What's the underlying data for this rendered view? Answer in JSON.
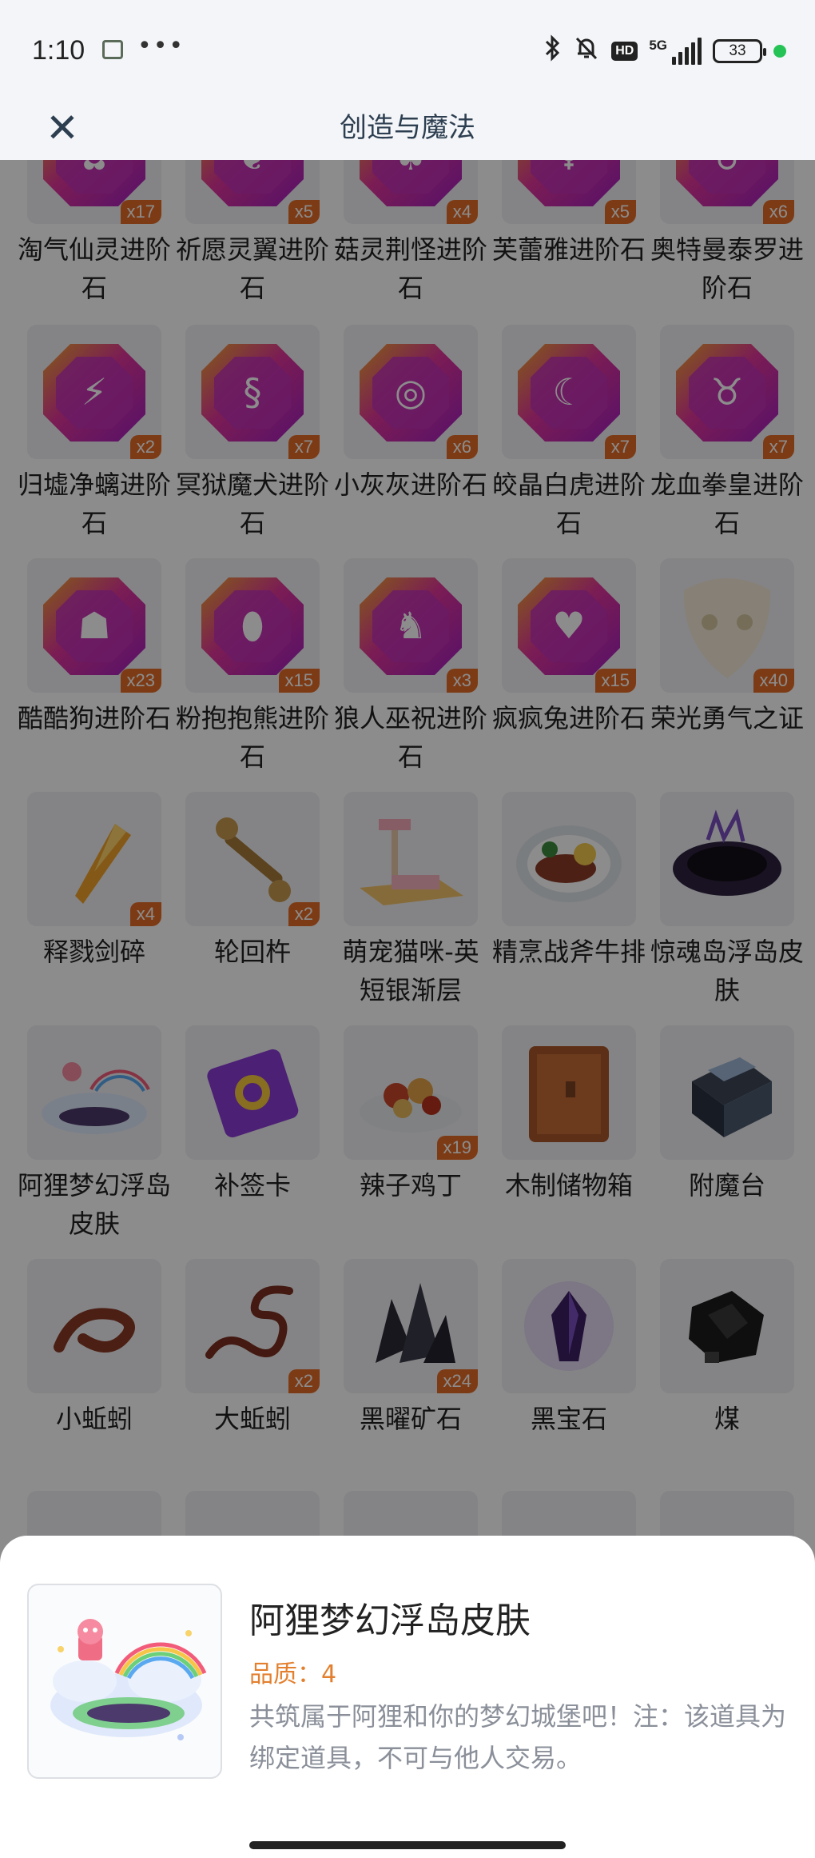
{
  "status_bar": {
    "time": "1:10",
    "dots": "•••",
    "network": "5G",
    "hd": "HD",
    "battery": "33"
  },
  "nav": {
    "title": "创造与魔法",
    "close_glyph": "✕"
  },
  "items": [
    {
      "name": "淘气仙灵进阶石",
      "qty": "x17",
      "icon": "gem-fairy-icon"
    },
    {
      "name": "祈愿灵翼进阶石",
      "qty": "x5",
      "icon": "gem-wing-icon"
    },
    {
      "name": "菇灵荆怪进阶石",
      "qty": "x4",
      "icon": "gem-mushroom-icon"
    },
    {
      "name": "芙蕾雅进阶石",
      "qty": "x5",
      "icon": "gem-freya-icon"
    },
    {
      "name": "奥特曼泰罗进阶石",
      "qty": "x6",
      "icon": "gem-ultraman-icon"
    },
    {
      "name": "归墟净螭进阶石",
      "qty": "x2",
      "icon": "gem-dragon-icon"
    },
    {
      "name": "冥狱魔犬进阶石",
      "qty": "x7",
      "icon": "gem-hellhound-icon"
    },
    {
      "name": "小灰灰进阶石",
      "qty": "x6",
      "icon": "gem-lollipop-icon"
    },
    {
      "name": "皎晶白虎进阶石",
      "qty": "x7",
      "icon": "gem-tiger-icon"
    },
    {
      "name": "龙血拳皇进阶石",
      "qty": "x7",
      "icon": "gem-horns-icon"
    },
    {
      "name": "酷酷狗进阶石",
      "qty": "x23",
      "icon": "gem-dog-icon"
    },
    {
      "name": "粉抱抱熊进阶石",
      "qty": "x15",
      "icon": "gem-egg-icon"
    },
    {
      "name": "狼人巫祝进阶石",
      "qty": "x3",
      "icon": "gem-werewolf-icon"
    },
    {
      "name": "疯疯兔进阶石",
      "qty": "x15",
      "icon": "gem-carrot-icon"
    },
    {
      "name": "荣光勇气之证",
      "qty": "x40",
      "icon": "glory-mask-icon"
    },
    {
      "name": "释戮剑碎",
      "qty": "x4",
      "icon": "sword-shard-icon"
    },
    {
      "name": "轮回杵",
      "qty": "x2",
      "icon": "pestle-icon"
    },
    {
      "name": "萌宠猫咪-英短银渐层",
      "qty": "",
      "icon": "cat-tower-icon"
    },
    {
      "name": "精烹战斧牛排",
      "qty": "",
      "icon": "steak-plate-icon"
    },
    {
      "name": "惊魂岛浮岛皮肤",
      "qty": "",
      "icon": "dark-island-icon"
    },
    {
      "name": "阿狸梦幻浮岛皮肤",
      "qty": "",
      "icon": "dream-island-icon"
    },
    {
      "name": "补签卡",
      "qty": "",
      "icon": "checkin-card-icon"
    },
    {
      "name": "辣子鸡丁",
      "qty": "x19",
      "icon": "spicy-chicken-icon"
    },
    {
      "name": "木制储物箱",
      "qty": "",
      "icon": "wooden-box-icon"
    },
    {
      "name": "附魔台",
      "qty": "",
      "icon": "enchant-table-icon"
    },
    {
      "name": "小蚯蚓",
      "qty": "",
      "icon": "small-worm-icon"
    },
    {
      "name": "大蚯蚓",
      "qty": "x2",
      "icon": "big-worm-icon"
    },
    {
      "name": "黑曜矿石",
      "qty": "x24",
      "icon": "obsidian-ore-icon"
    },
    {
      "name": "黑宝石",
      "qty": "",
      "icon": "black-gem-icon"
    },
    {
      "name": "煤",
      "qty": "",
      "icon": "coal-icon"
    },
    {
      "name": "",
      "qty": "",
      "icon": "partial-item-icon"
    },
    {
      "name": "",
      "qty": "",
      "icon": "partial-item-icon"
    },
    {
      "name": "",
      "qty": "",
      "icon": "partial-item-icon"
    },
    {
      "name": "",
      "qty": "",
      "icon": "partial-item-icon"
    },
    {
      "name": "",
      "qty": "",
      "icon": "partial-item-icon"
    }
  ],
  "detail": {
    "title": "阿狸梦幻浮岛皮肤",
    "quality": "品质：4",
    "description": "共筑属于阿狸和你的梦幻城堡吧！注：该道具为绑定道具，不可与他人交易。",
    "icon": "dream-island-icon"
  },
  "colors": {
    "accent_orange": "#e36c27",
    "quality_orange": "#e3802f",
    "gem_purple": "#a020c0",
    "gem_gold": "#f2a82a"
  }
}
